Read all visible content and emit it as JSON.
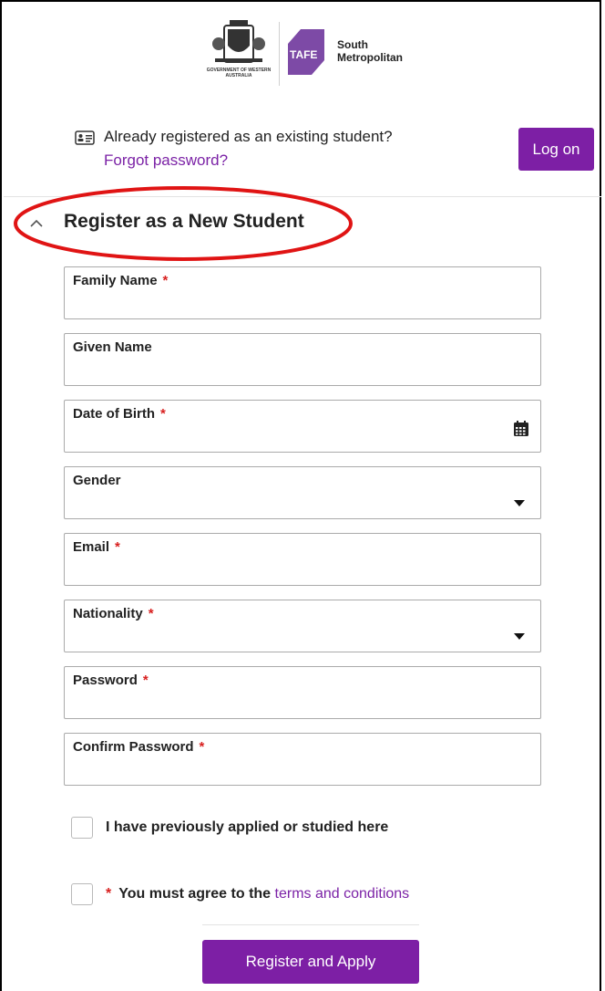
{
  "header": {
    "gov_logo_text": "GOVERNMENT OF WESTERN AUSTRALIA",
    "tafe_badge": "TAFE",
    "college_name_line1": "South",
    "college_name_line2": "Metropolitan"
  },
  "existing_student": {
    "prompt": "Already registered as an existing student?",
    "forgot_password": "Forgot password?",
    "logon_label": "Log on"
  },
  "section": {
    "title": "Register as a New Student",
    "expanded": true
  },
  "fields": {
    "family_name": {
      "label": "Family Name",
      "required": "*",
      "value": ""
    },
    "given_name": {
      "label": "Given Name",
      "value": ""
    },
    "date_of_birth": {
      "label": "Date of Birth",
      "required": "*",
      "value": ""
    },
    "gender": {
      "label": "Gender",
      "selected": ""
    },
    "email": {
      "label": "Email",
      "required": "*",
      "value": ""
    },
    "nationality": {
      "label": "Nationality",
      "required": "*",
      "selected": ""
    },
    "password": {
      "label": "Password",
      "required": "*",
      "value": ""
    },
    "confirm_password": {
      "label": "Confirm Password",
      "required": "*",
      "value": ""
    }
  },
  "checkboxes": {
    "previously_applied": {
      "label": "I have previously applied or studied here",
      "checked": false
    },
    "terms": {
      "required": "*",
      "label": "You must agree to the",
      "link": "terms and conditions",
      "checked": false
    }
  },
  "submit_label": "Register and Apply",
  "icons": {
    "id_card": "id-card-icon",
    "chevron": "chevron-up-icon",
    "calendar": "calendar-icon",
    "caret": "caret-down-icon"
  },
  "colors": {
    "brand_purple": "#7d1fa5",
    "required_red": "#d8201f",
    "annotation_red": "#e01414"
  }
}
